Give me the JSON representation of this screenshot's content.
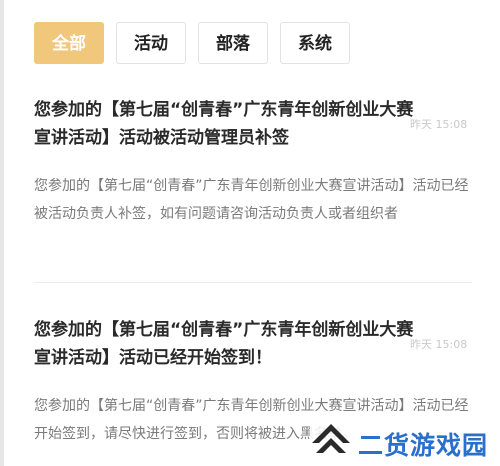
{
  "tabs": [
    {
      "label": "全部",
      "active": true
    },
    {
      "label": "活动",
      "active": false
    },
    {
      "label": "部落",
      "active": false
    },
    {
      "label": "系统",
      "active": false
    }
  ],
  "messages": [
    {
      "title": "您参加的【第七届“创青春”广东青年创新创业大赛宣讲活动】活动被活动管理员补签",
      "time": "昨天 15:08",
      "body": "您参加的【第七届“创青春”广东青年创新创业大赛宣讲活动】活动已经被活动负责人补签，如有问题请咨询活动负责人或者组织者"
    },
    {
      "title": "您参加的【第七届“创青春”广东青年创新创业大赛宣讲活动】活动已经开始签到！",
      "time": "昨天 15:08",
      "body": "您参加的【第七届“创青春”广东青年创新创业大赛宣讲活动】活动已经开始签到，请尽快进行签到，否则将被进入黑名单。"
    }
  ],
  "watermark": {
    "text": "二货游戏园"
  },
  "colors": {
    "active_tab": "#f0c77b",
    "watermark": "#2a6fc9"
  }
}
